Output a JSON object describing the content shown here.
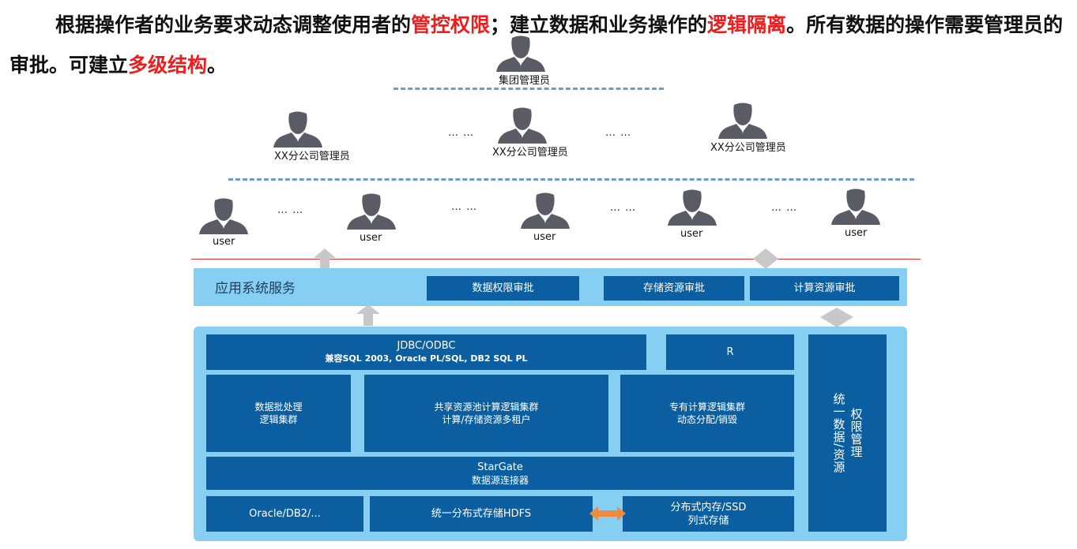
{
  "headline": {
    "p1": "根据操作者的业务要求动态调整使用者的",
    "h1": "管控权限",
    "p2": "；建立数据和业务操作的",
    "h2": "逻辑隔离",
    "p3": "。所有数据的操作需要管理员的审批。可建立",
    "h3": "多级结构",
    "p4": "。"
  },
  "hierarchy": {
    "group_admin": "集团管理员",
    "branch_admins": [
      "XX分公司管理员",
      "XX分公司管理员",
      "XX分公司管理员"
    ],
    "users": [
      "user",
      "user",
      "user",
      "user",
      "user"
    ],
    "ellipsis": "… …"
  },
  "services": {
    "title": "应用系统服务",
    "approvals": [
      "数据权限审批",
      "存储资源审批",
      "计算资源审批"
    ]
  },
  "platform": {
    "jdbc": {
      "title": "JDBC/ODBC",
      "subtitle": "兼容SQL 2003, Oracle PL/SQL, DB2 SQL PL"
    },
    "r": "R",
    "batch": {
      "line1": "数据批处理",
      "line2": "逻辑集群"
    },
    "shared": {
      "line1": "共享资源池计算逻辑集群",
      "line2": "计算/存储资源多租户"
    },
    "dedicated": {
      "line1": "专有计算逻辑集群",
      "line2": "动态分配/销毁"
    },
    "stargate": {
      "line1": "StarGate",
      "line2": "数据源连接器"
    },
    "oracle": "Oracle/DB2/...",
    "hdfs": "统一分布式存储HDFS",
    "memory": {
      "line1": "分布式内存/SSD",
      "line2": "列式存储"
    },
    "permission": {
      "col1": "统一数据/资源",
      "col2": "权限管理"
    }
  },
  "colors": {
    "highlight": "#ee1c1c",
    "box_blue": "#0b5fa0",
    "panel_light": "#86cff2",
    "person_gray": "#5b5b66",
    "arrow_gray": "#c8c8c8",
    "arrow_orange": "#f08a3c"
  }
}
